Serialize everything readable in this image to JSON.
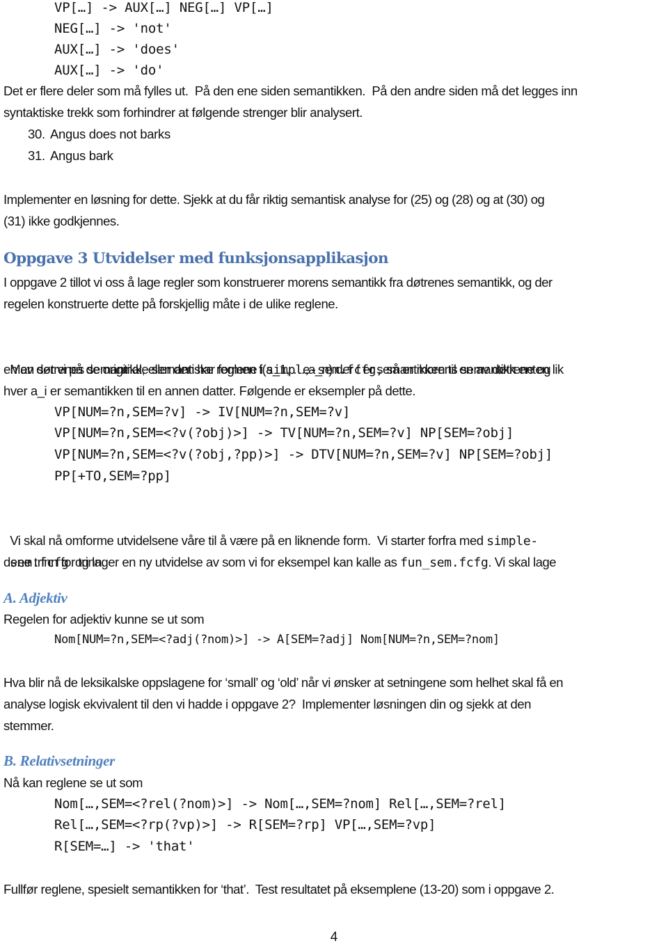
{
  "code_block_1": [
    "VP[…] -> AUX[…] NEG[…] VP[…]",
    "NEG[…] -> 'not'",
    "AUX[…] -> 'does'",
    "AUX[…] -> 'do'"
  ],
  "para_1": [
    "Det er flere deler som må fylles ut.  På den ene siden semantikken.  På den andre siden må det legges inn",
    "syntaktiske trekk som forhindrer at følgende strenger blir analysert."
  ],
  "examples": [
    {
      "number": "30.",
      "text": "Angus does not barks"
    },
    {
      "number": "31.",
      "text": "Angus bark"
    }
  ],
  "para_2": [
    "Implementer en løsning for dette. Sjekk at du får riktig semantisk analyse for (25) og (28) og at (30) og",
    "(31) ikke godkjennes."
  ],
  "section_heading": "Oppgave 3 Utvidelser med funksjonsapplikasjon",
  "para_3": [
    "I oppgave 2 tillot vi oss å lage regler som konstruerer morens semantikk fra døtrenes semantikk, og der",
    "regelen konstruerte dette på forskjellig måte i de ulike reglene."
  ],
  "para_4": {
    "line1_before": "Men ser vi på de originale semantiske reglene i ",
    "line1_code": "simple-sem.fcfg,",
    "line1_after": " så er morens semantikk enten lik",
    "line2": "en av døtrenes semantikk, eller den har formen f(a_1, …,a_n) der f er semantikken til en av døtrene og",
    "line3": "hver a_i er semantikken til en annen datter. Følgende er eksempler på dette."
  },
  "code_block_2": [
    "VP[NUM=?n,SEM=?v] -> IV[NUM=?n,SEM=?v]",
    "VP[NUM=?n,SEM=<?v(?obj)>] -> TV[NUM=?n,SEM=?v] NP[SEM=?obj]",
    "VP[NUM=?n,SEM=<?v(?obj,?pp)>] -> DTV[NUM=?n,SEM=?v] NP[SEM=?obj]",
    "PP[+TO,SEM=?pp]"
  ],
  "para_5": {
    "line1_before": "Vi skal nå omforme utvidelsene våre til å være på en liknende form.  Vi starter forfra med ",
    "line1_code": "simple-",
    "line2_code1": "sem.fcfg",
    "line2_mid": "  og lager en ny utvidelse av som vi for eksempel kan kalle as ",
    "line2_code2": "fun_sem.fcfg",
    "line2_after": ". Vi skal lage",
    "line3": "dene trinn for trinn."
  },
  "subsection_a": {
    "heading": "A. Adjektiv",
    "intro": "Regelen for adjektiv kunne se ut som",
    "code": [
      "Nom[NUM=?n,SEM=<?adj(?nom)>] -> A[SEM=?adj] Nom[NUM=?n,SEM=?nom]"
    ],
    "question": [
      "Hva blir nå de leksikalske oppslagene for ‘small’ og ‘old’ når vi ønsker at setningene som helhet skal få en",
      "analyse logisk ekvivalent til den vi hadde i oppgave 2?  Implementer løsningen din og sjekk at den",
      "stemmer."
    ]
  },
  "subsection_b": {
    "heading": "B. Relativsetninger",
    "intro": "Nå kan reglene se ut som",
    "code": [
      "Nom[…,SEM=<?rel(?nom)>] -> Nom[…,SEM=?nom] Rel[…,SEM=?rel]",
      "Rel[…,SEM=<?rp(?vp)>] -> R[SEM=?rp] VP[…,SEM=?vp]",
      "R[SEM=…] -> 'that'"
    ],
    "task": "Fullfør reglene, spesielt semantikken for ‘that’.  Test resultatet på eksemplene (13-20) som i oppgave 2."
  },
  "page_number": "4",
  "colors": {
    "heading_blue": "#4a71ab",
    "subheading_blue": "#4f81bd",
    "text": "#111111"
  }
}
